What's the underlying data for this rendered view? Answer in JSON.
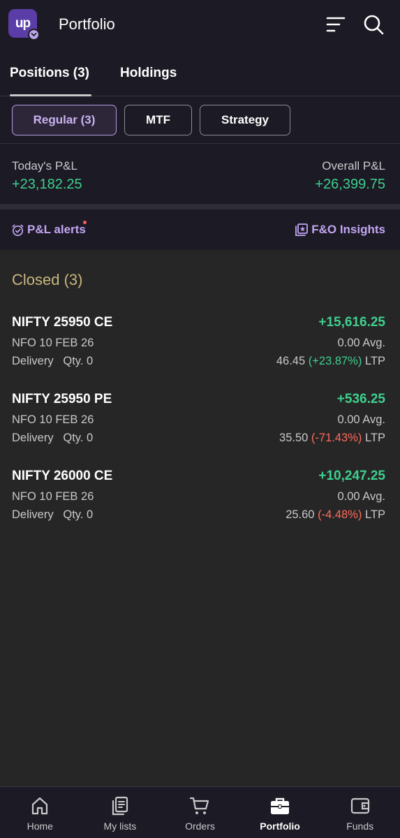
{
  "header": {
    "logo_text": "up",
    "title": "Portfolio"
  },
  "tabs": [
    {
      "label": "Positions (3)",
      "active": true
    },
    {
      "label": "Holdings",
      "active": false
    }
  ],
  "filters": [
    {
      "label": "Regular (3)",
      "active": true
    },
    {
      "label": "MTF",
      "active": false
    },
    {
      "label": "Strategy",
      "active": false
    }
  ],
  "pnl": {
    "today_label": "Today's P&L",
    "today_value": "+23,182.25",
    "overall_label": "Overall P&L",
    "overall_value": "+26,399.75"
  },
  "links": {
    "alerts": "P&L alerts",
    "insights": "F&O Insights"
  },
  "section": {
    "title": "Closed (3)"
  },
  "positions": [
    {
      "name": "NIFTY 25950 CE",
      "pnl": "+15,616.25",
      "exchange_expiry": "NFO 10 FEB 26",
      "avg": "0.00 Avg.",
      "product": "Delivery",
      "qty": "Qty. 0",
      "ltp": "46.45",
      "change": "(+23.87%)",
      "ltp_suffix": "LTP"
    },
    {
      "name": "NIFTY 25950 PE",
      "pnl": "+536.25",
      "exchange_expiry": "NFO 10 FEB 26",
      "avg": "0.00 Avg.",
      "product": "Delivery",
      "qty": "Qty. 0",
      "ltp": "35.50",
      "change": "(-71.43%)",
      "ltp_suffix": "LTP"
    },
    {
      "name": "NIFTY 26000 CE",
      "pnl": "+10,247.25",
      "exchange_expiry": "NFO 10 FEB 26",
      "avg": "0.00 Avg.",
      "product": "Delivery",
      "qty": "Qty. 0",
      "ltp": "25.60",
      "change": "(-4.48%)",
      "ltp_suffix": "LTP"
    }
  ],
  "nav": [
    {
      "label": "Home",
      "icon": "home-icon"
    },
    {
      "label": "My lists",
      "icon": "lists-icon"
    },
    {
      "label": "Orders",
      "icon": "cart-icon"
    },
    {
      "label": "Portfolio",
      "icon": "briefcase-icon",
      "active": true
    },
    {
      "label": "Funds",
      "icon": "wallet-icon"
    }
  ],
  "colors": {
    "profit": "#3fcf8e",
    "loss": "#ff6b5b",
    "accent": "#c2a6f4",
    "section": "#c8b67d"
  }
}
